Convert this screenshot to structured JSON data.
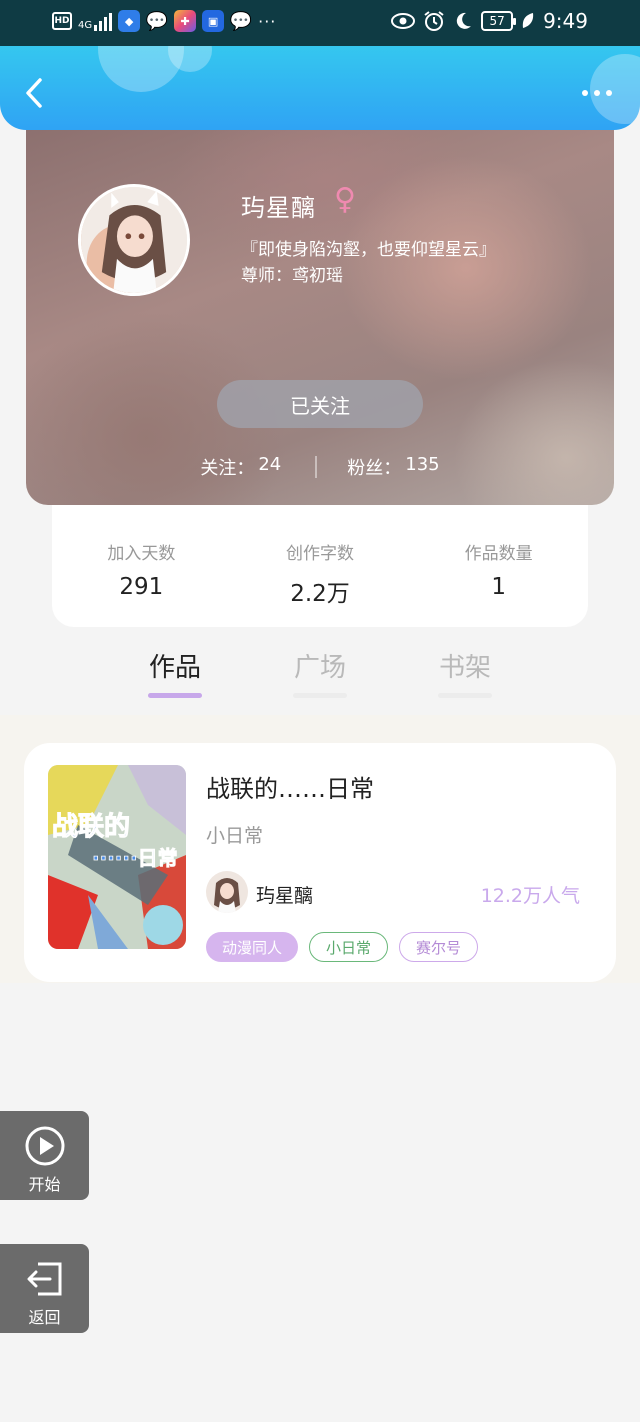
{
  "status_bar": {
    "hd": "HD",
    "network": "4G",
    "more": "···",
    "battery": "57",
    "time": "9:49"
  },
  "nav": {
    "back_icon": "chevron-left-icon",
    "more_icon": "more-horizontal-icon"
  },
  "profile": {
    "name": "玙星醨",
    "gender_symbol": "♀",
    "motto": "『即使身陷沟壑，也要仰望星云』",
    "teacher": "尊师：鸢初瑶",
    "follow_button": "已关注",
    "following_label": "关注：",
    "following_count": "24",
    "fans_label": "粉丝：",
    "fans_count": "135"
  },
  "stats": [
    {
      "label": "加入天数",
      "value": "291"
    },
    {
      "label": "创作字数",
      "value": "2.2万"
    },
    {
      "label": "作品数量",
      "value": "1"
    }
  ],
  "tabs": [
    {
      "label": "作品",
      "active": true
    },
    {
      "label": "广场",
      "active": false
    },
    {
      "label": "书架",
      "active": false
    }
  ],
  "works": [
    {
      "title": "战联的……日常",
      "subtitle": "小日常",
      "author": "玙星醨",
      "popularity": "12.2万人气",
      "tags": [
        "动漫同人",
        "小日常",
        "赛尔号"
      ]
    }
  ],
  "floating": {
    "start_label": "开始",
    "back_label": "返回"
  },
  "colors": {
    "nav_top": "#35c7ef",
    "nav_bottom": "#2fa3f4",
    "accent_purple": "#c7a7ea",
    "tag_green": "#6ab87a"
  }
}
